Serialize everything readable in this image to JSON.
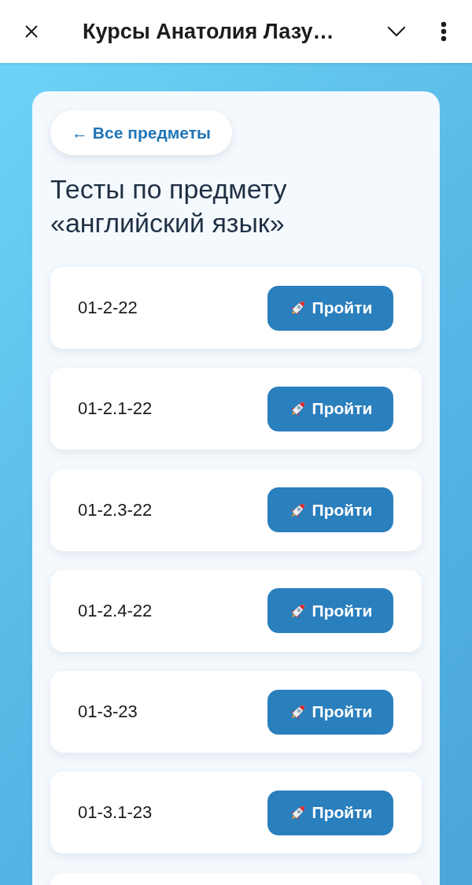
{
  "app_bar": {
    "title": "Курсы Анатолия Лазу…"
  },
  "back_link": {
    "label": "← Все предметы"
  },
  "heading": "Тесты по предмету «английский язык»",
  "tests": [
    {
      "name": "01-2-22",
      "button": "Пройти"
    },
    {
      "name": "01-2.1-22",
      "button": "Пройти"
    },
    {
      "name": "01-2.3-22",
      "button": "Пройти"
    },
    {
      "name": "01-2.4-22",
      "button": "Пройти"
    },
    {
      "name": "01-3-23",
      "button": "Пройти"
    },
    {
      "name": "01-3.1-23",
      "button": "Пройти"
    }
  ],
  "list_continues": true
}
